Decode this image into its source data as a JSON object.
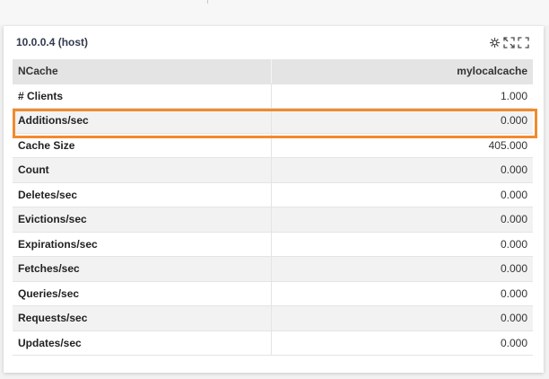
{
  "panel": {
    "title": "10.0.0.4 (host)",
    "tools": [
      {
        "icon": "settings-icon"
      },
      {
        "icon": "expand-icon"
      },
      {
        "icon": "fullscreen-icon"
      }
    ]
  },
  "table": {
    "header": {
      "name": "NCache",
      "cache": "mylocalcache"
    },
    "rows": [
      {
        "name": "# Clients",
        "value": "1.000"
      },
      {
        "name": "Additions/sec",
        "value": "0.000"
      },
      {
        "name": "Cache Size",
        "value": "405.000"
      },
      {
        "name": "Count",
        "value": "0.000"
      },
      {
        "name": "Deletes/sec",
        "value": "0.000"
      },
      {
        "name": "Evictions/sec",
        "value": "0.000"
      },
      {
        "name": "Expirations/sec",
        "value": "0.000"
      },
      {
        "name": "Fetches/sec",
        "value": "0.000"
      },
      {
        "name": "Queries/sec",
        "value": "0.000"
      },
      {
        "name": "Requests/sec",
        "value": "0.000"
      },
      {
        "name": "Updates/sec",
        "value": "0.000"
      }
    ]
  },
  "colors": {
    "highlight": "#f28a2e",
    "header_bg": "#e4e4e4",
    "title": "#333a4d"
  }
}
